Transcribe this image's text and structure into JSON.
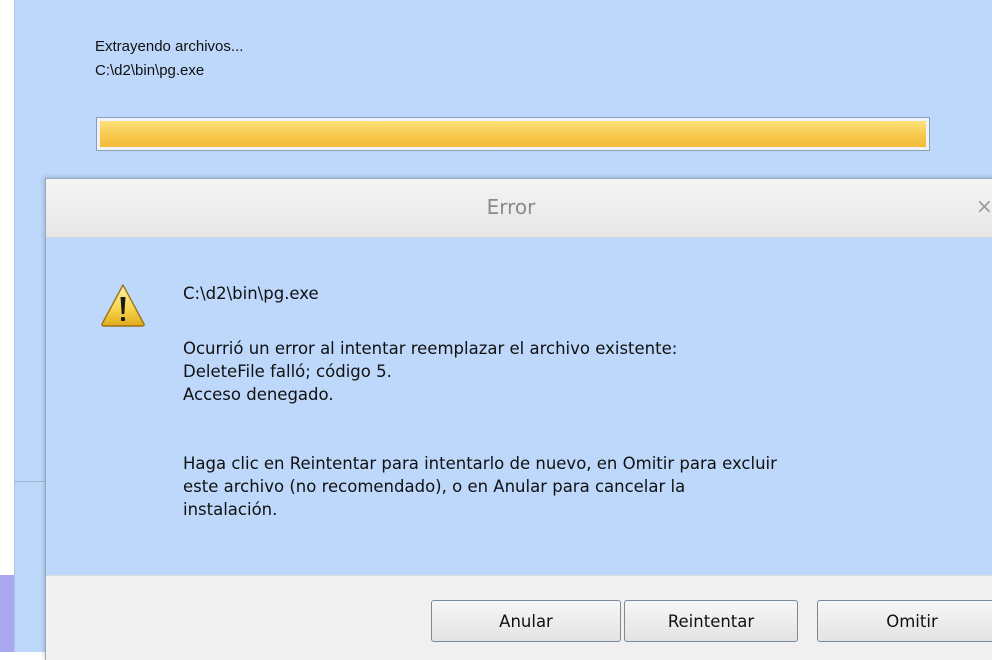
{
  "installer": {
    "status_line1": "Extrayendo archivos...",
    "status_line2": "C:\\d2\\bin\\pg.exe",
    "progress_percent": 100,
    "progress_color": "#f7c94d"
  },
  "dialog": {
    "title": "Error",
    "close_glyph": "×",
    "icon": "warning-icon",
    "lines": [
      "C:\\d2\\bin\\pg.exe",
      "Ocurrió un error al intentar reemplazar el archivo existente:",
      "DeleteFile falló; código 5.",
      "Acceso denegado.",
      "Haga clic en Reintentar para intentarlo de nuevo, en Omitir para excluir",
      "este archivo (no recomendado), o en Anular para cancelar la",
      "instalación."
    ],
    "buttons": {
      "abort": "Anular",
      "retry": "Reintentar",
      "ignore": "Omitir"
    }
  }
}
